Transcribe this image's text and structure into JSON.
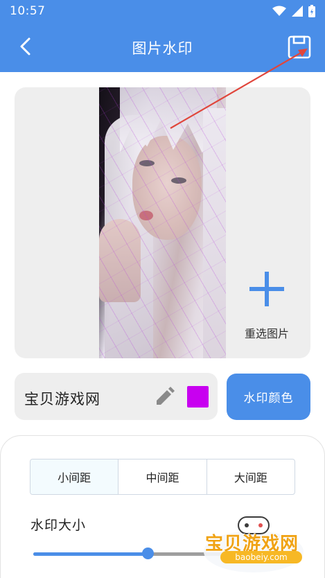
{
  "status_bar": {
    "time": "10:57"
  },
  "app_bar": {
    "title": "图片水印"
  },
  "preview": {
    "reselect_label": "重选图片"
  },
  "watermark": {
    "text": "宝贝游戏网",
    "color": "#c800f0",
    "color_button_label": "水印颜色"
  },
  "spacing": {
    "options": [
      {
        "label": "小间距"
      },
      {
        "label": "中间距"
      },
      {
        "label": "大间距"
      }
    ],
    "selected": "小间距"
  },
  "size": {
    "label": "水印大小",
    "value_fraction": 0.44
  },
  "overlay": {
    "brand_name": "宝贝游戏网",
    "brand_url": "baobeiy.com"
  },
  "colors": {
    "accent": "#4a8ee8",
    "arrow": "#e0463c"
  }
}
